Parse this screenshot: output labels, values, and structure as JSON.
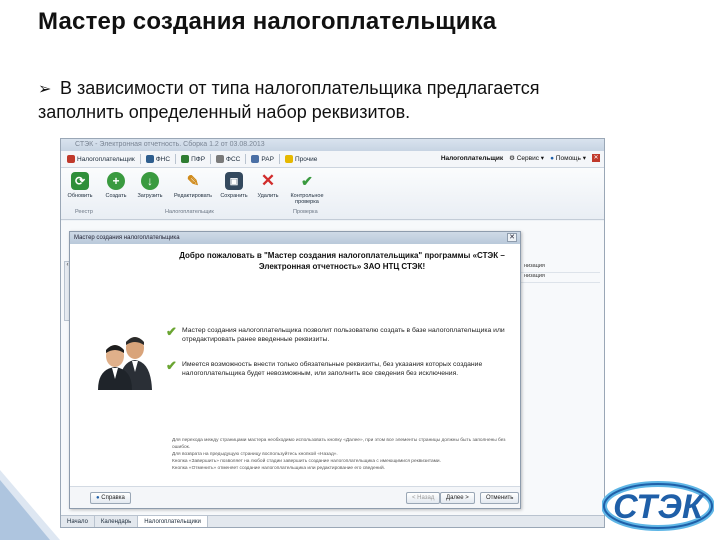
{
  "slide": {
    "title": "Мастер создания налогоплательщика",
    "bullet_line1": "В зависимости от типа налогоплательщика предлагается",
    "bullet_line2": "заполнить определенный набор реквизитов.",
    "bullet_icon": "arrow-bullet-icon"
  },
  "app": {
    "window_title": "СТЭК - Электронная отчетность. Сборка 1.2 от 03.08.2013",
    "nav": {
      "items": [
        {
          "label": "Налогоплательщик",
          "icon": "user-icon",
          "color": "#c0392b"
        },
        {
          "label": "ФНС",
          "icon": "fns-icon",
          "color": "#2e5e8e"
        },
        {
          "label": "ПФР",
          "icon": "pfr-icon",
          "color": "#2f7d32"
        },
        {
          "label": "ФСС",
          "icon": "fss-icon",
          "color": "#7a7a7a"
        },
        {
          "label": "РАР",
          "icon": "rar-icon",
          "color": "#4a6fa5"
        },
        {
          "label": "Прочие",
          "icon": "folder-icon",
          "color": "#e6b800"
        }
      ],
      "right": [
        "Налогоплательщик",
        "Сервис",
        "Помощь"
      ]
    },
    "ribbon": {
      "buttons": [
        "Обновить",
        "Создать",
        "Загрузить",
        "Редактировать",
        "Сохранить",
        "Удалить",
        "Контрольное проверка"
      ],
      "groups": [
        "Реестр",
        "Налогоплательщик",
        "Проверка"
      ]
    },
    "background_rows": [
      "низация",
      "низация"
    ],
    "status_tabs": [
      "Начало",
      "Календарь",
      "Налогоплательщики"
    ]
  },
  "wizard": {
    "title": "Мастер создания налогоплательщика",
    "welcome": "Добро пожаловать в \"Мастер создания налогоплательщика\" программы «СТЭК – Электронная отчетность» ЗАО НТЦ СТЭК!",
    "checks": [
      "Мастер создания налогоплательщика позволит пользователю создать в базе налогоплательщика или отредактировать ранее введенные реквизиты.",
      "Имеется возможность внести только обязательные реквизиты, без указания которых создание налогоплательщика будет невозможным, или заполнить все сведения без исключения."
    ],
    "hints": [
      "Для перехода между страницами мастера необходимо использовать кнопку «Далее», при этом все элементы страницы должны быть заполнены без ошибок.",
      "Для возврата на предыдущую страницу воспользуйтесь кнопкой «Назад».",
      "Кнопка «Завершить» позволяет на любой стадии завершить создание налогоплательщика с имеющимися реквизитами.",
      "Кнопка «Отменить» отменяет создание налогоплательщика или редактирование его сведений."
    ],
    "buttons": {
      "help": "Справка",
      "back": "< Назад",
      "next": "Далее >",
      "cancel": "Отменить"
    }
  },
  "colors": {
    "accent_blue": "#1f5fa8",
    "check_green": "#6aa532"
  }
}
